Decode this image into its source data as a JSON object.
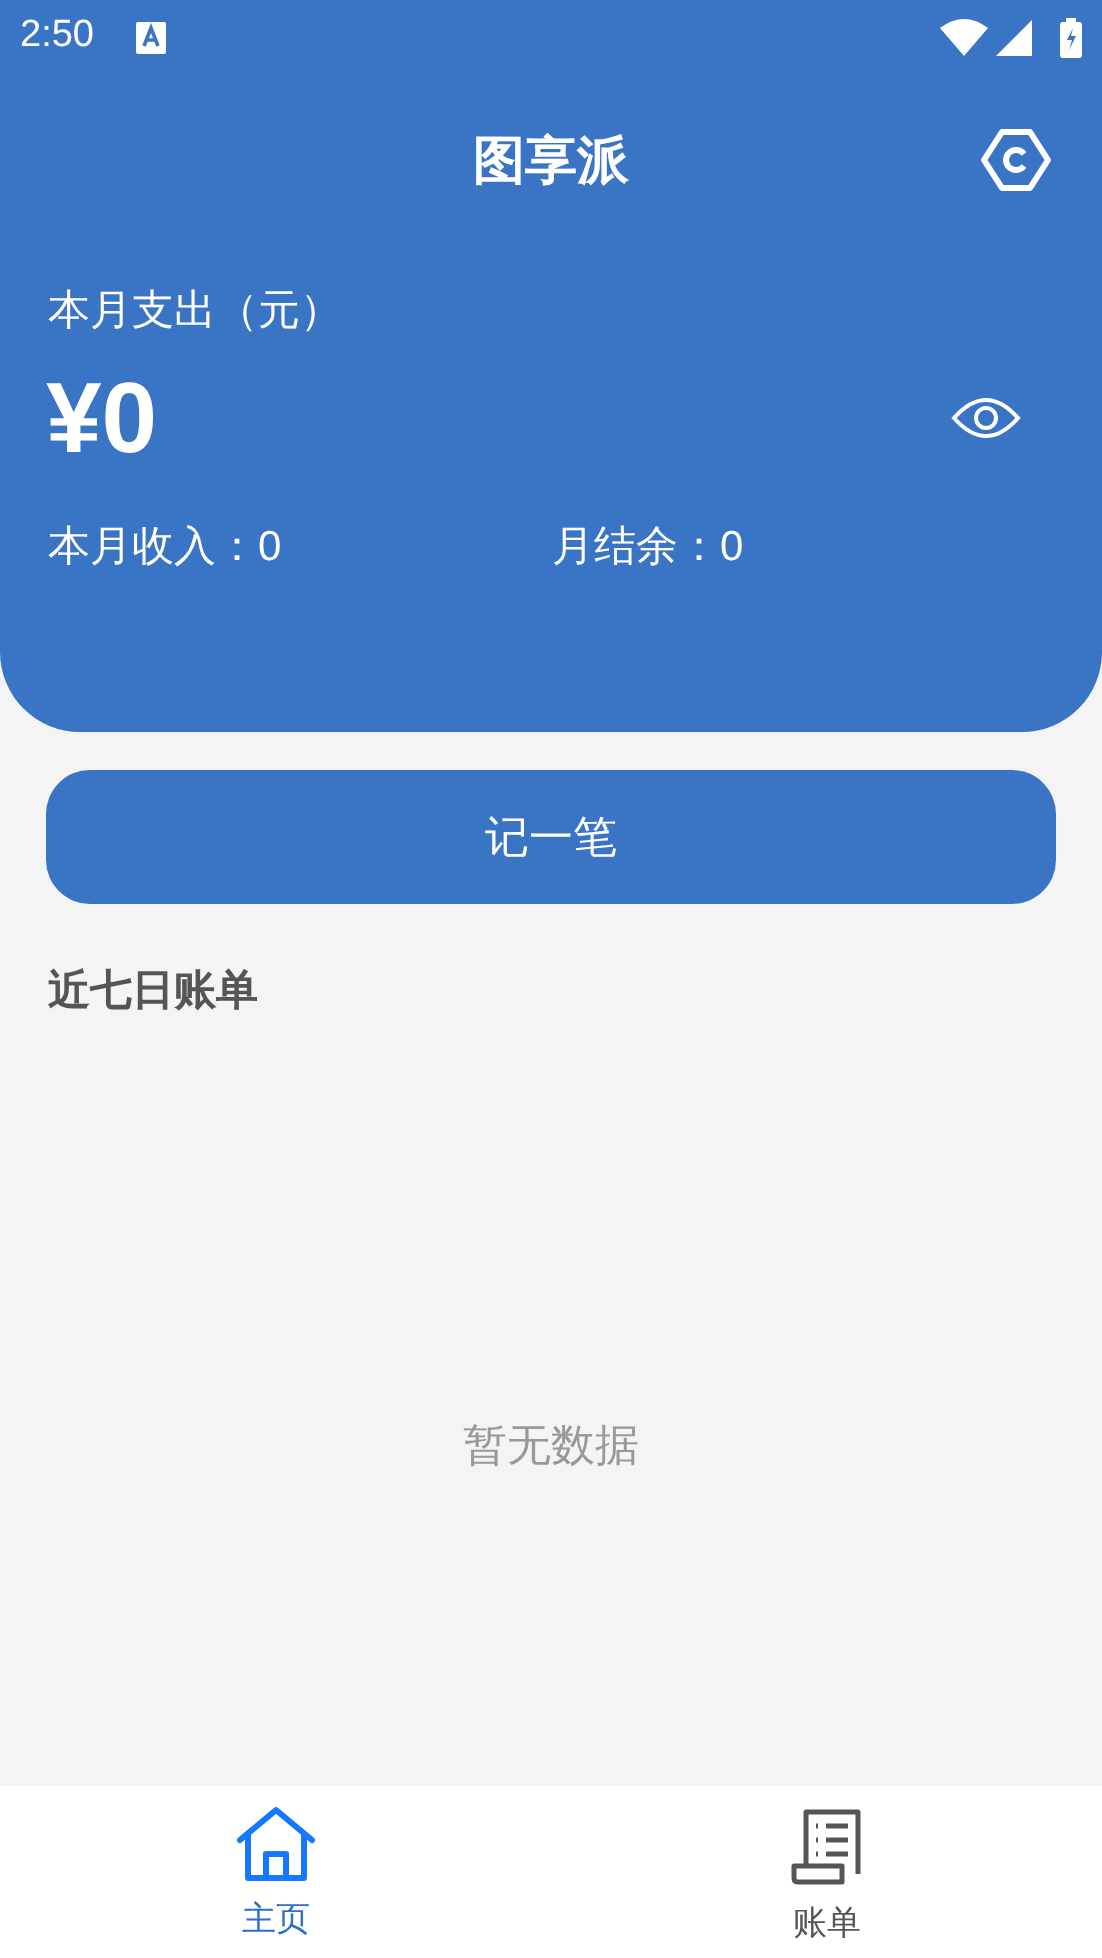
{
  "status_bar": {
    "time": "2:50"
  },
  "header": {
    "title": "图享派",
    "expense_label": "本月支出（元）",
    "expense_amount": "¥0",
    "income": "本月收入：0",
    "balance": "月结余：0"
  },
  "record_button": "记一笔",
  "recent": {
    "title": "近七日账单",
    "empty_text": "暂无数据"
  },
  "tabs": [
    {
      "label": "主页",
      "kind": "home",
      "selected": true
    },
    {
      "label": "账单",
      "kind": "bill",
      "selected": false
    }
  ]
}
